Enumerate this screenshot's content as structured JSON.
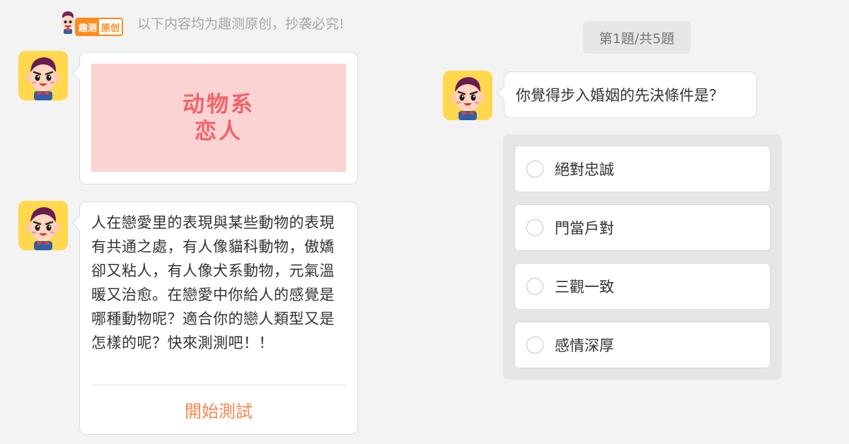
{
  "header": {
    "logo": {
      "part1": "趣测",
      "part2": "原创"
    },
    "notice": "以下内容均为趣测原创，抄袭必究!"
  },
  "intro": {
    "banner_lines": [
      "动物系",
      "恋人"
    ],
    "description": "人在戀愛里的表現與某些動物的表現有共通之處，有人像貓科動物，傲嬌卻又粘人，有人像犬系動物，元氣溫暖又治愈。在戀愛中你給人的感覺是哪種動物呢？適合你的戀人類型又是怎樣的呢？快來測測吧！！",
    "start_button": "開始測試"
  },
  "quiz": {
    "progress": "第1題/共5題",
    "question": "你覺得步入婚姻的先決條件是？",
    "options": [
      "絕對忠誠",
      "門當戶對",
      "三觀一致",
      "感情深厚"
    ]
  },
  "colors": {
    "background": "#f3f3f3",
    "avatar_bg": "#ffd84d",
    "banner_bg": "#fcd3d3",
    "banner_text": "#f0646a",
    "accent_orange": "#f5874f",
    "logo_orange": "#ff8a1c"
  },
  "icons": {
    "avatar": "mascot-avatar-icon",
    "radio": "radio-unchecked-icon"
  }
}
